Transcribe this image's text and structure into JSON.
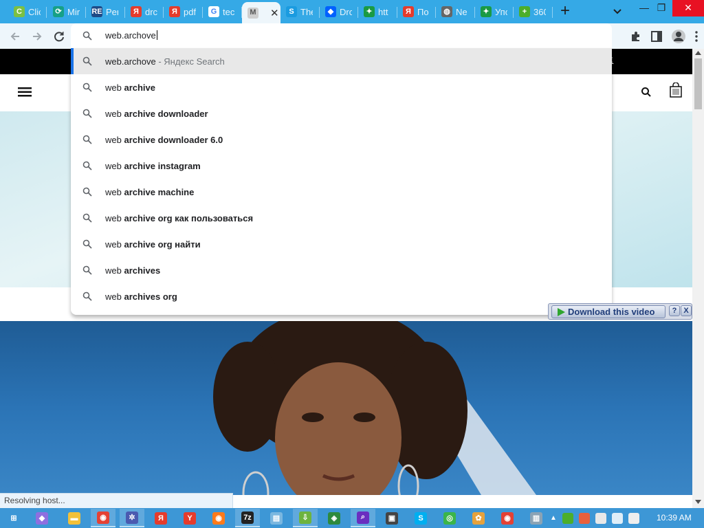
{
  "tabs": [
    {
      "label": "Clic",
      "color": "#7bc043",
      "glyph": "C"
    },
    {
      "label": "Mir",
      "color": "#16a086",
      "glyph": "⟳"
    },
    {
      "label": "Per",
      "color": "#1e4a86",
      "glyph": "RE"
    },
    {
      "label": "drc",
      "color": "#e53b2c",
      "glyph": "Я"
    },
    {
      "label": "pdf",
      "color": "#e53b2c",
      "glyph": "Я"
    },
    {
      "label": "tec",
      "color": "#ffffff",
      "glyph": "G"
    },
    {
      "label": "",
      "color": "#cfcfcf",
      "glyph": "M",
      "active": true
    },
    {
      "label": "The",
      "color": "#1a9be0",
      "glyph": "S"
    },
    {
      "label": "Drc",
      "color": "#0061fe",
      "glyph": "◆"
    },
    {
      "label": "htt",
      "color": "#1a9a43",
      "glyph": "✦"
    },
    {
      "label": "По",
      "color": "#e53b2c",
      "glyph": "Я"
    },
    {
      "label": "Ne",
      "color": "#666666",
      "glyph": "◍"
    },
    {
      "label": "Упс",
      "color": "#1a9a43",
      "glyph": "✦"
    },
    {
      "label": "360",
      "color": "#4cae2b",
      "glyph": "+"
    }
  ],
  "window": {
    "minimize": "—",
    "restore": "❐",
    "close": "✕",
    "new_tab": "+"
  },
  "omnibox": {
    "value": "web.archove",
    "suggestions": [
      {
        "plain": "web.archove",
        "bold": "",
        "sub": " - Яндекс Search",
        "selected": true
      },
      {
        "plain": "web ",
        "bold": "archive",
        "sub": ""
      },
      {
        "plain": "web ",
        "bold": "archive downloader",
        "sub": ""
      },
      {
        "plain": "web ",
        "bold": "archive downloader 6.0",
        "sub": ""
      },
      {
        "plain": "web ",
        "bold": "archive instagram",
        "sub": ""
      },
      {
        "plain": "web ",
        "bold": "archive machine",
        "sub": ""
      },
      {
        "plain": "web ",
        "bold": "archive org как пользоваться",
        "sub": ""
      },
      {
        "plain": "web ",
        "bold": "archive org найти",
        "sub": ""
      },
      {
        "plain": "web ",
        "bold": "archives",
        "sub": ""
      },
      {
        "plain": "web ",
        "bold": "archives org",
        "sub": ""
      }
    ]
  },
  "page": {
    "promo_link": "E"
  },
  "download_widget": {
    "label": "Download this video",
    "help": "?",
    "close": "X"
  },
  "status": "Resolving host...",
  "taskbar": {
    "items": [
      {
        "name": "start",
        "color": "#3d97d6",
        "glyph": "⊞"
      },
      {
        "name": "cortana",
        "color": "#8e6fe0",
        "glyph": "◆"
      },
      {
        "name": "explorer",
        "color": "#f3c13a",
        "glyph": "▬"
      },
      {
        "name": "chrome",
        "color": "#e44134",
        "glyph": "◉",
        "open": true
      },
      {
        "name": "settings",
        "color": "#4a5ab0",
        "glyph": "✲",
        "open": true
      },
      {
        "name": "yandex",
        "color": "#e53b2c",
        "glyph": "Я"
      },
      {
        "name": "yandex-browser",
        "color": "#e53b2c",
        "glyph": "Y"
      },
      {
        "name": "firefox",
        "color": "#ff7a1a",
        "glyph": "◉"
      },
      {
        "name": "7zip",
        "color": "#222222",
        "glyph": "7z",
        "open": true
      },
      {
        "name": "notepad",
        "color": "#7ab7e0",
        "glyph": "▤"
      },
      {
        "name": "downloader",
        "color": "#6db33f",
        "glyph": "⇩",
        "open": true
      },
      {
        "name": "globe",
        "color": "#2d8a3e",
        "glyph": "◈"
      },
      {
        "name": "search-app",
        "color": "#6a2fc0",
        "glyph": "⌕",
        "open": true
      },
      {
        "name": "media",
        "color": "#444444",
        "glyph": "▣"
      },
      {
        "name": "skype",
        "color": "#00aff0",
        "glyph": "S"
      },
      {
        "name": "green-app",
        "color": "#3bb54a",
        "glyph": "◎"
      },
      {
        "name": "photos",
        "color": "#e6a23c",
        "glyph": "✿"
      },
      {
        "name": "chrome-2",
        "color": "#e44134",
        "glyph": "◉"
      },
      {
        "name": "bin",
        "color": "#8aa3b5",
        "glyph": "▥"
      }
    ],
    "clock": "10:39 AM"
  }
}
